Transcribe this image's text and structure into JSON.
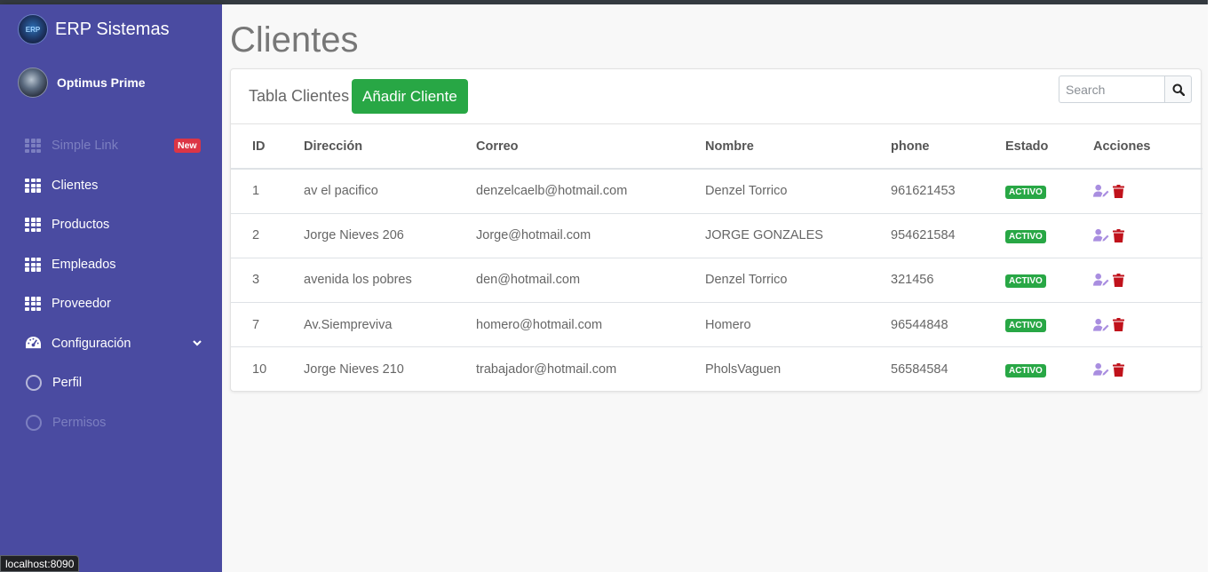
{
  "sidebar": {
    "brand": {
      "name": "ERP Sistemas",
      "logo_text": "ERP"
    },
    "user": {
      "name": "Optimus Prime"
    },
    "items": [
      {
        "label": "Simple Link",
        "badge": "New",
        "icon": "grid-icon",
        "disabled": true
      },
      {
        "label": "Clientes",
        "icon": "grid-icon"
      },
      {
        "label": "Productos",
        "icon": "grid-icon"
      },
      {
        "label": "Empleados",
        "icon": "grid-icon"
      },
      {
        "label": "Proveedor",
        "icon": "grid-icon"
      },
      {
        "label": "Configuración",
        "icon": "gauge-icon",
        "expandable": true
      },
      {
        "label": "Perfil",
        "icon": "circle-icon"
      },
      {
        "label": "Permisos",
        "icon": "circle-icon",
        "disabled": true
      }
    ]
  },
  "page": {
    "title": "Clientes"
  },
  "card": {
    "title": "Tabla Clientes",
    "add_button": "Añadir Cliente",
    "search": {
      "placeholder": "Search"
    }
  },
  "table": {
    "columns": [
      "ID",
      "Dirección",
      "Correo",
      "Nombre",
      "phone",
      "Estado",
      "Acciones"
    ],
    "rows": [
      {
        "id": "1",
        "direccion": "av el pacifico",
        "correo": "denzelcaelb@hotmail.com",
        "nombre": "Denzel Torrico",
        "phone": "961621453",
        "estado": "ACTIVO"
      },
      {
        "id": "2",
        "direccion": "Jorge Nieves 206",
        "correo": "Jorge@hotmail.com",
        "nombre": "JORGE GONZALES",
        "phone": "954621584",
        "estado": "ACTIVO"
      },
      {
        "id": "3",
        "direccion": "avenida los pobres",
        "correo": "den@hotmail.com",
        "nombre": "Denzel Torrico",
        "phone": "321456",
        "estado": "ACTIVO"
      },
      {
        "id": "7",
        "direccion": "Av.Siempreviva",
        "correo": "homero@hotmail.com",
        "nombre": "Homero",
        "phone": "96544848",
        "estado": "ACTIVO"
      },
      {
        "id": "10",
        "direccion": "Jorge Nieves 210",
        "correo": "trabajador@hotmail.com",
        "nombre": "PholsVaguen",
        "phone": "56584584",
        "estado": "ACTIVO"
      }
    ]
  },
  "statusbar": {
    "url": "localhost:8090"
  },
  "colors": {
    "sidebar": "#4a4ba1",
    "accent_green": "#28a745",
    "danger": "#dc3545",
    "edit_icon": "#a98ee0",
    "delete_icon": "#c0121b"
  }
}
